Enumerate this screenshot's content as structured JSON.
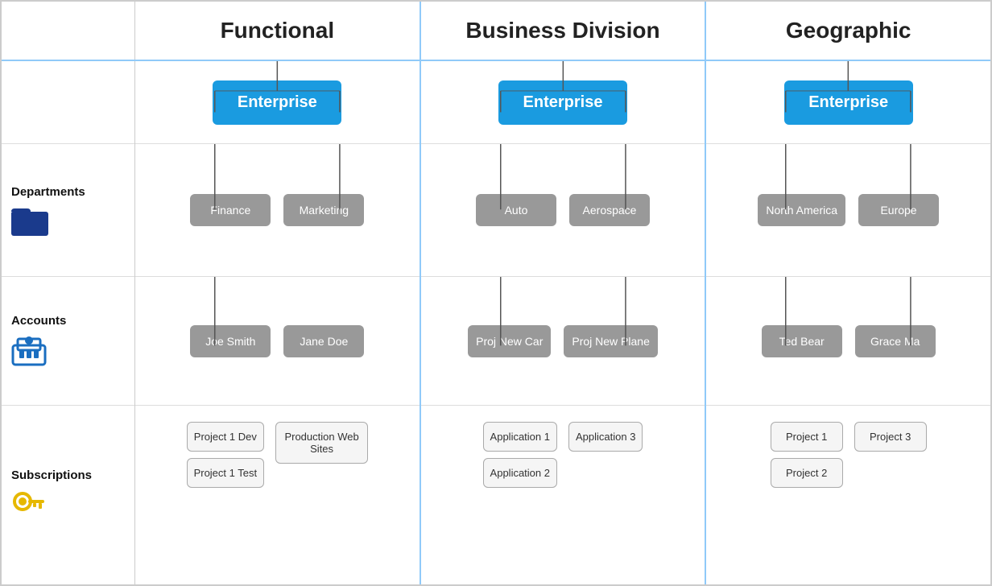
{
  "headers": {
    "functional": "Functional",
    "business_division": "Business Division",
    "geographic": "Geographic"
  },
  "labels": {
    "departments": "Departments",
    "accounts": "Accounts",
    "subscriptions": "Subscriptions"
  },
  "functional": {
    "enterprise": "Enterprise",
    "departments": [
      "Finance",
      "Marketing"
    ],
    "accounts": [
      "Joe Smith",
      "Jane Doe"
    ],
    "subscriptions_left": [
      "Project 1 Dev",
      "Project 1 Test"
    ],
    "subscriptions_right": [
      "Production Web Sites"
    ]
  },
  "business": {
    "enterprise": "Enterprise",
    "departments": [
      "Auto",
      "Aerospace"
    ],
    "accounts": [
      "Proj New Car",
      "Proj New Plane"
    ],
    "subscriptions_left": [
      "Application 1",
      "Application 2"
    ],
    "subscriptions_right": [
      "Application 3"
    ]
  },
  "geographic": {
    "enterprise": "Enterprise",
    "departments": [
      "North America",
      "Europe"
    ],
    "accounts": [
      "Ted Bear",
      "Grace Ma"
    ],
    "subscriptions_left": [
      "Project 1",
      "Project 2"
    ],
    "subscriptions_right": [
      "Project 3"
    ]
  }
}
